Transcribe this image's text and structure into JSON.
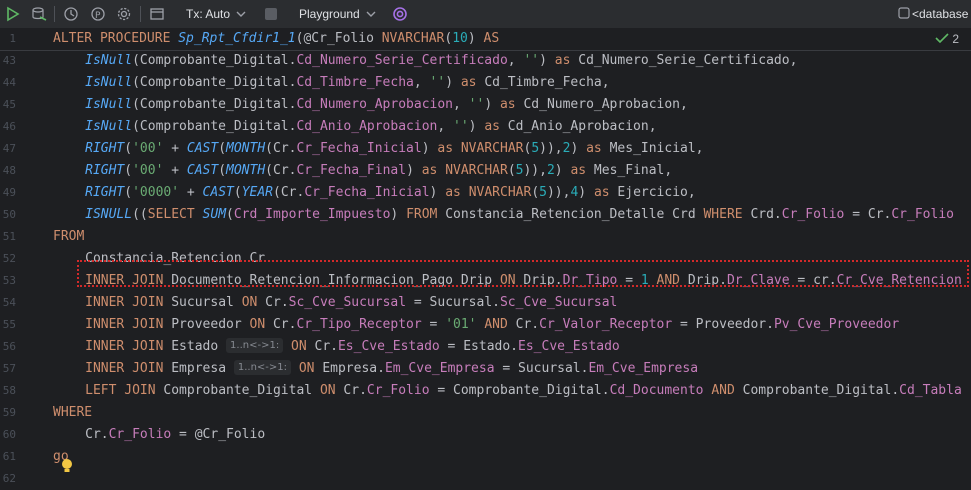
{
  "toolbar": {
    "tx_label": "Tx: Auto",
    "playground_label": "Playground",
    "database_label": "<database"
  },
  "sticky": {
    "line_number": "1",
    "line": [
      [
        "kw",
        "ALTER PROCEDURE "
      ],
      [
        "fn",
        "Sp_Rpt_Cfdir1_1"
      ],
      [
        "pl",
        "(@Cr_Folio "
      ],
      [
        "kw",
        "NVARCHAR"
      ],
      [
        "pl",
        "("
      ],
      [
        "num",
        "10"
      ],
      [
        "pl",
        ") "
      ],
      [
        "kw",
        "AS"
      ]
    ],
    "inspection_count": "2"
  },
  "lines": [
    {
      "n": "43",
      "indent": 4,
      "tokens": [
        [
          "fn",
          "IsNull"
        ],
        [
          "pl",
          "(Comprobante_Digital."
        ],
        [
          "col",
          "Cd_Numero_Serie_Certificado"
        ],
        [
          "pl",
          ", "
        ],
        [
          "str",
          "''"
        ],
        [
          "pl",
          ") "
        ],
        [
          "kw",
          "as"
        ],
        [
          "pl",
          " Cd_Numero_Serie_Certificado,"
        ]
      ]
    },
    {
      "n": "44",
      "indent": 4,
      "tokens": [
        [
          "fn",
          "IsNull"
        ],
        [
          "pl",
          "(Comprobante_Digital."
        ],
        [
          "col",
          "Cd_Timbre_Fecha"
        ],
        [
          "pl",
          ", "
        ],
        [
          "str",
          "''"
        ],
        [
          "pl",
          ") "
        ],
        [
          "kw",
          "as"
        ],
        [
          "pl",
          " Cd_Timbre_Fecha,"
        ]
      ]
    },
    {
      "n": "45",
      "indent": 4,
      "tokens": [
        [
          "fn",
          "IsNull"
        ],
        [
          "pl",
          "(Comprobante_Digital."
        ],
        [
          "col",
          "Cd_Numero_Aprobacion"
        ],
        [
          "pl",
          ", "
        ],
        [
          "str",
          "''"
        ],
        [
          "pl",
          ") "
        ],
        [
          "kw",
          "as"
        ],
        [
          "pl",
          " Cd_Numero_Aprobacion,"
        ]
      ]
    },
    {
      "n": "46",
      "indent": 4,
      "tokens": [
        [
          "fn",
          "IsNull"
        ],
        [
          "pl",
          "(Comprobante_Digital."
        ],
        [
          "col",
          "Cd_Anio_Aprobacion"
        ],
        [
          "pl",
          ", "
        ],
        [
          "str",
          "''"
        ],
        [
          "pl",
          ") "
        ],
        [
          "kw",
          "as"
        ],
        [
          "pl",
          " Cd_Anio_Aprobacion,"
        ]
      ]
    },
    {
      "n": "47",
      "indent": 4,
      "tokens": [
        [
          "fn",
          "RIGHT"
        ],
        [
          "pl",
          "("
        ],
        [
          "str",
          "'00'"
        ],
        [
          "pl",
          " + "
        ],
        [
          "fn",
          "CAST"
        ],
        [
          "pl",
          "("
        ],
        [
          "fn",
          "MONTH"
        ],
        [
          "pl",
          "(Cr."
        ],
        [
          "col",
          "Cr_Fecha_Inicial"
        ],
        [
          "pl",
          ") "
        ],
        [
          "kw",
          "as"
        ],
        [
          "pl",
          " "
        ],
        [
          "kw",
          "NVARCHAR"
        ],
        [
          "pl",
          "("
        ],
        [
          "num",
          "5"
        ],
        [
          "pl",
          ")),"
        ],
        [
          "num",
          "2"
        ],
        [
          "pl",
          ") "
        ],
        [
          "kw",
          "as"
        ],
        [
          "pl",
          " Mes_Inicial,"
        ]
      ]
    },
    {
      "n": "48",
      "indent": 4,
      "tokens": [
        [
          "fn",
          "RIGHT"
        ],
        [
          "pl",
          "("
        ],
        [
          "str",
          "'00'"
        ],
        [
          "pl",
          " + "
        ],
        [
          "fn",
          "CAST"
        ],
        [
          "pl",
          "("
        ],
        [
          "fn",
          "MONTH"
        ],
        [
          "pl",
          "(Cr."
        ],
        [
          "col",
          "Cr_Fecha_Final"
        ],
        [
          "pl",
          ") "
        ],
        [
          "kw",
          "as"
        ],
        [
          "pl",
          " "
        ],
        [
          "kw",
          "NVARCHAR"
        ],
        [
          "pl",
          "("
        ],
        [
          "num",
          "5"
        ],
        [
          "pl",
          ")),"
        ],
        [
          "num",
          "2"
        ],
        [
          "pl",
          ") "
        ],
        [
          "kw",
          "as"
        ],
        [
          "pl",
          " Mes_Final,"
        ]
      ]
    },
    {
      "n": "49",
      "indent": 4,
      "tokens": [
        [
          "fn",
          "RIGHT"
        ],
        [
          "pl",
          "("
        ],
        [
          "str",
          "'0000'"
        ],
        [
          "pl",
          " + "
        ],
        [
          "fn",
          "CAST"
        ],
        [
          "pl",
          "("
        ],
        [
          "fn",
          "YEAR"
        ],
        [
          "pl",
          "(Cr."
        ],
        [
          "col",
          "Cr_Fecha_Inicial"
        ],
        [
          "pl",
          ") "
        ],
        [
          "kw",
          "as"
        ],
        [
          "pl",
          " "
        ],
        [
          "kw",
          "NVARCHAR"
        ],
        [
          "pl",
          "("
        ],
        [
          "num",
          "5"
        ],
        [
          "pl",
          ")),"
        ],
        [
          "num",
          "4"
        ],
        [
          "pl",
          ") "
        ],
        [
          "kw",
          "as"
        ],
        [
          "pl",
          " Ejercicio,"
        ]
      ]
    },
    {
      "n": "50",
      "indent": 4,
      "tokens": [
        [
          "fn",
          "ISNULL"
        ],
        [
          "pl",
          "(("
        ],
        [
          "kw",
          "SELECT "
        ],
        [
          "fn",
          "SUM"
        ],
        [
          "pl",
          "("
        ],
        [
          "col",
          "Crd_Importe_Impuesto"
        ],
        [
          "pl",
          ") "
        ],
        [
          "kw",
          "FROM"
        ],
        [
          "pl",
          " Constancia_Retencion_Detalle Crd "
        ],
        [
          "kw",
          "WHERE"
        ],
        [
          "pl",
          " Crd."
        ],
        [
          "col",
          "Cr_Folio"
        ],
        [
          "pl",
          " = Cr."
        ],
        [
          "col",
          "Cr_Folio"
        ]
      ]
    },
    {
      "n": "51",
      "indent": 0,
      "tokens": [
        [
          "kw",
          "FROM"
        ]
      ]
    },
    {
      "n": "52",
      "indent": 4,
      "tokens": [
        [
          "pl",
          "Constancia_Retencion Cr"
        ]
      ]
    },
    {
      "n": "53",
      "indent": 4,
      "tokens": [
        [
          "kw",
          "INNER JOIN"
        ],
        [
          "pl",
          " Documento_Retencion_Informacion_Pago Drip "
        ],
        [
          "kw",
          "ON"
        ],
        [
          "pl",
          " Drip."
        ],
        [
          "col",
          "Dr_Tipo"
        ],
        [
          "pl",
          " = "
        ],
        [
          "num",
          "1"
        ],
        [
          "pl",
          " "
        ],
        [
          "kw",
          "AND"
        ],
        [
          "pl",
          " Drip."
        ],
        [
          "col",
          "Dr_Clave"
        ],
        [
          "pl",
          " = cr."
        ],
        [
          "col",
          "Cr_Cve_Retencion"
        ]
      ]
    },
    {
      "n": "54",
      "indent": 4,
      "tokens": [
        [
          "kw",
          "INNER JOIN"
        ],
        [
          "pl",
          " Sucursal "
        ],
        [
          "kw",
          "ON"
        ],
        [
          "pl",
          " Cr."
        ],
        [
          "col",
          "Sc_Cve_Sucursal"
        ],
        [
          "pl",
          " = Sucursal."
        ],
        [
          "col",
          "Sc_Cve_Sucursal"
        ]
      ]
    },
    {
      "n": "55",
      "indent": 4,
      "tokens": [
        [
          "kw",
          "INNER JOIN"
        ],
        [
          "pl",
          " Proveedor "
        ],
        [
          "kw",
          "ON"
        ],
        [
          "pl",
          " Cr."
        ],
        [
          "col",
          "Cr_Tipo_Receptor"
        ],
        [
          "pl",
          " = "
        ],
        [
          "str",
          "'01'"
        ],
        [
          "pl",
          " "
        ],
        [
          "kw",
          "AND"
        ],
        [
          "pl",
          " Cr."
        ],
        [
          "col",
          "Cr_Valor_Receptor"
        ],
        [
          "pl",
          " = Proveedor."
        ],
        [
          "col",
          "Pv_Cve_Proveedor"
        ]
      ]
    },
    {
      "n": "56",
      "indent": 4,
      "tokens": [
        [
          "kw",
          "INNER JOIN"
        ],
        [
          "pl",
          " Estado "
        ],
        [
          "hint",
          "1..n<->1:"
        ],
        [
          "pl",
          " "
        ],
        [
          "kw",
          "ON"
        ],
        [
          "pl",
          " Cr."
        ],
        [
          "col",
          "Es_Cve_Estado"
        ],
        [
          "pl",
          " = Estado."
        ],
        [
          "col",
          "Es_Cve_Estado"
        ]
      ]
    },
    {
      "n": "57",
      "indent": 4,
      "tokens": [
        [
          "kw",
          "INNER JOIN"
        ],
        [
          "pl",
          " Empresa "
        ],
        [
          "hint",
          "1..n<->1:"
        ],
        [
          "pl",
          " "
        ],
        [
          "kw",
          "ON"
        ],
        [
          "pl",
          " Empresa."
        ],
        [
          "col",
          "Em_Cve_Empresa"
        ],
        [
          "pl",
          " = Sucursal."
        ],
        [
          "col",
          "Em_Cve_Empresa"
        ]
      ]
    },
    {
      "n": "58",
      "indent": 4,
      "tokens": [
        [
          "kw",
          "LEFT JOIN"
        ],
        [
          "pl",
          " Comprobante_Digital "
        ],
        [
          "kw",
          "ON"
        ],
        [
          "pl",
          " Cr."
        ],
        [
          "col",
          "Cr_Folio"
        ],
        [
          "pl",
          " = Comprobante_Digital."
        ],
        [
          "col",
          "Cd_Documento"
        ],
        [
          "pl",
          " "
        ],
        [
          "kw",
          "AND"
        ],
        [
          "pl",
          " Comprobante_Digital."
        ],
        [
          "col",
          "Cd_Tabla"
        ]
      ]
    },
    {
      "n": "59",
      "indent": 0,
      "tokens": [
        [
          "kw",
          "WHERE"
        ]
      ]
    },
    {
      "n": "60",
      "indent": 4,
      "tokens": [
        [
          "pl",
          "Cr."
        ],
        [
          "col",
          "Cr_Folio"
        ],
        [
          "pl",
          " = @Cr_Folio"
        ]
      ]
    },
    {
      "n": "61",
      "indent": 0,
      "tokens": [
        [
          "kw",
          "go"
        ]
      ]
    },
    {
      "n": "62",
      "indent": 0,
      "tokens": []
    }
  ]
}
